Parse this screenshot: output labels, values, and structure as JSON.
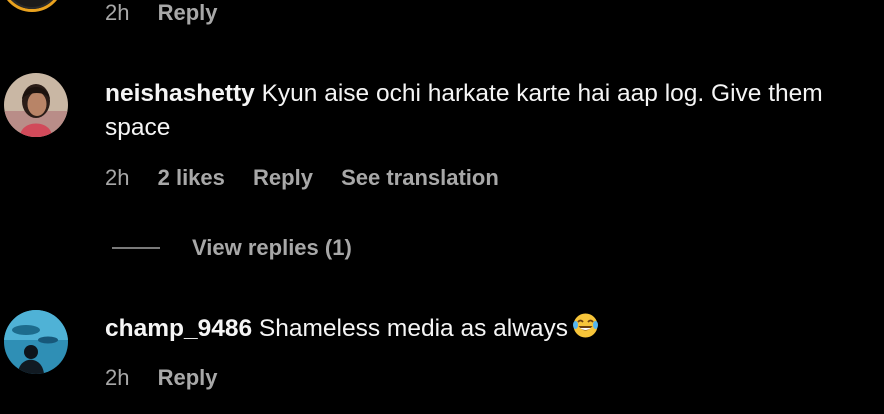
{
  "comments": [
    {
      "time": "2h",
      "reply_label": "Reply"
    },
    {
      "username": "neishashetty",
      "text": "Kyun aise ochi harkate karte hai aap log. Give them space",
      "time": "2h",
      "likes": "2 likes",
      "reply_label": "Reply",
      "translation_label": "See translation",
      "view_replies_label": "View replies (1)"
    },
    {
      "username": "champ_9486",
      "text": "Shameless media as always",
      "emoji": "laughing-tears-emoji",
      "time": "2h",
      "reply_label": "Reply"
    }
  ],
  "colors": {
    "background": "#000000",
    "primary_text": "#f5f5f5",
    "secondary_text": "#a8a8a8",
    "story_ring": "#e9a21f"
  }
}
